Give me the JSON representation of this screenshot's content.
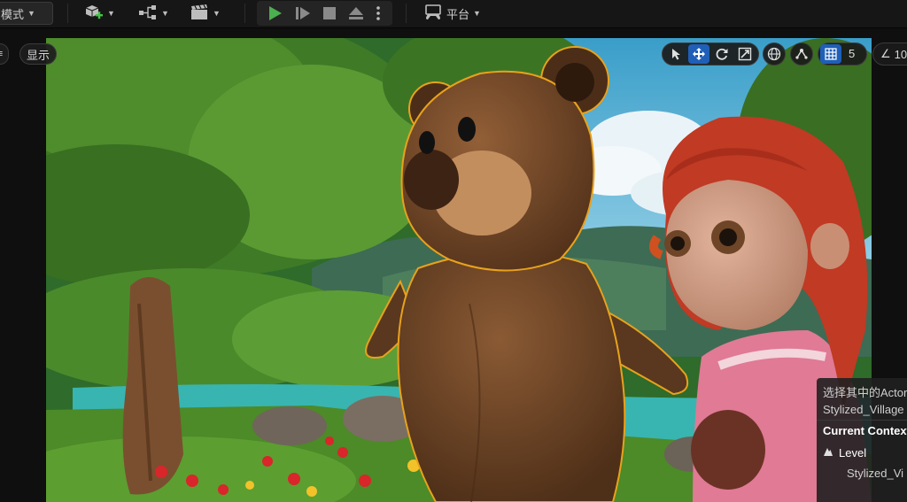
{
  "toolbar": {
    "mode_label": "模式",
    "platform_label": "平台",
    "icons": [
      "add-actor-icon",
      "blueprint-icon",
      "cinematics-icon",
      "play-icon",
      "advance-frame-icon",
      "stop-icon",
      "eject-icon",
      "more-icon",
      "platform-icon"
    ]
  },
  "viewport": {
    "left_pill_label": "显示",
    "gizmo_tools": [
      "select-icon",
      "translate-icon",
      "rotate-icon",
      "scale-icon"
    ],
    "active_tool": "translate-icon",
    "grid_snap_value": "5",
    "angle_snap_value": "10"
  },
  "info_panel": {
    "selection_text": "选择其中的Actor",
    "actor_name": "Stylized_Village",
    "context_header": "Current Context",
    "level_label": "Level",
    "level_value": "Stylized_Vi"
  },
  "colors": {
    "toolbar_bg": "#161616",
    "play_green": "#4caf50",
    "active_blue": "#1f5fb8",
    "selection_outline": "#e8a21c"
  }
}
